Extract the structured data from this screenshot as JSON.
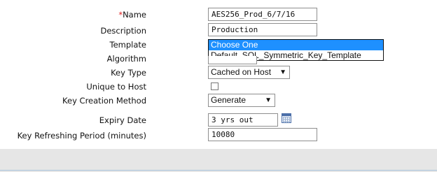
{
  "form": {
    "name": {
      "required_mark": "*",
      "label": "Name",
      "value": "AES256_Prod_6/7/16"
    },
    "description": {
      "label": "Description",
      "value": "Production"
    },
    "template": {
      "label": "Template",
      "options": [
        "Choose One",
        "Default_SQL_Symmetric_Key_Template"
      ],
      "highlighted": "Choose One"
    },
    "algorithm": {
      "label": "Algorithm"
    },
    "key_type": {
      "label": "Key Type",
      "value": "Cached on Host"
    },
    "unique_to_host": {
      "label": "Unique to Host",
      "checked": false
    },
    "key_creation_method": {
      "label": "Key Creation Method",
      "value": "Generate"
    },
    "expiry_date": {
      "label": "Expiry Date",
      "value": "3 yrs out",
      "icon": "calendar-icon"
    },
    "key_refreshing_period": {
      "label": "Key Refreshing Period (minutes)",
      "value": "10080"
    }
  },
  "colors": {
    "required": "#e02020",
    "highlight": "#1e90ff",
    "footer": "#e6e6e6"
  }
}
